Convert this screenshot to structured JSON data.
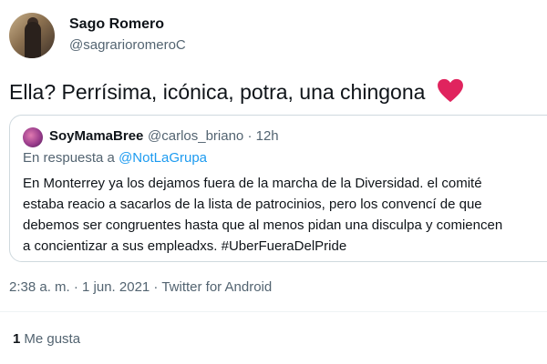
{
  "author": {
    "display_name": "Sago Romero",
    "handle": "@sagrarioromeroC"
  },
  "tweet": {
    "text": "Ella? Perrísima, icónica, potra, una chingona",
    "emoji": "heart-icon",
    "timestamp": "2:38 a. m. · 1 jun. 2021 · Twitter for Android"
  },
  "quoted_tweet": {
    "display_name": "SoyMamaBree",
    "handle": "@carlos_briano",
    "time": "· 12h",
    "reply_prefix": "En respuesta a",
    "reply_mention": "@NotLaGrupa",
    "text_lines": [
      "En Monterrey ya los dejamos fuera de la marcha de la Diversidad. el comité",
      "estaba reacio a sacarlos de la lista de patrocinios, pero los convencí de que",
      "debemos ser congruentes hasta que al menos pidan una disculpa y comiencen",
      "a concientizar a sus empleadxs. #UberFueraDelPride"
    ]
  },
  "engagement": {
    "likes_count": "1",
    "likes_label": "Me gusta"
  },
  "colors": {
    "heart": "#e0245e",
    "link": "#1d9bf0",
    "muted": "#536471"
  }
}
